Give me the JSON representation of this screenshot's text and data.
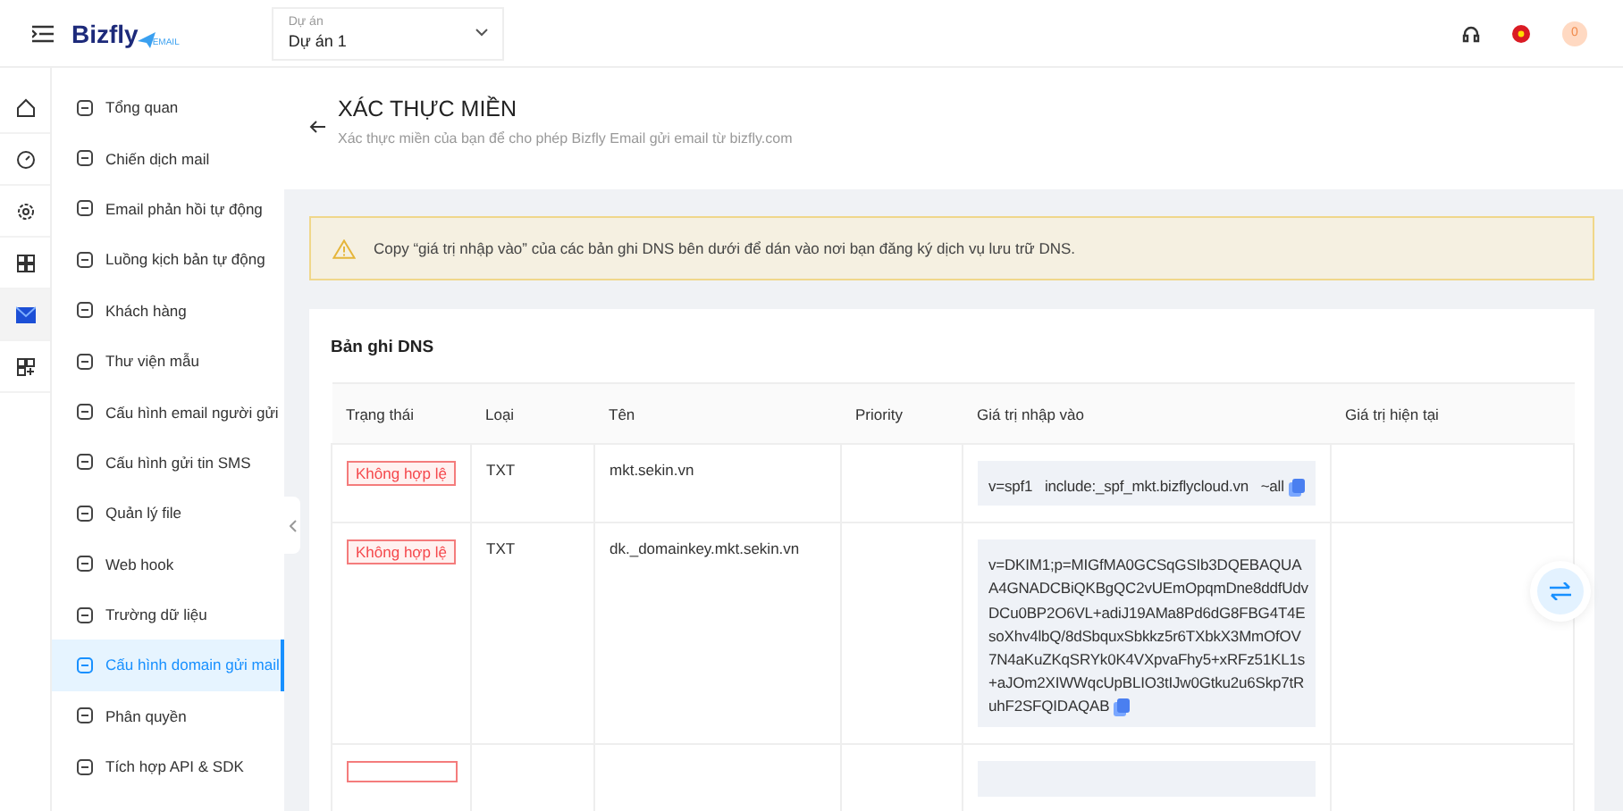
{
  "header": {
    "logo": "Bizfly",
    "logo_sub": "EMAIL",
    "project": {
      "label": "Dự án",
      "value": "Dự án 1"
    },
    "notification_count": "0"
  },
  "rail": [
    {
      "selected": false
    },
    {
      "selected": false
    },
    {
      "selected": false
    },
    {
      "selected": false
    },
    {
      "selected": true
    },
    {
      "selected": false
    }
  ],
  "sidebar": {
    "items": [
      {
        "label": "Tổng quan",
        "selected": false
      },
      {
        "label": "Chiến dịch mail",
        "selected": false
      },
      {
        "label": "Email phản hồi tự động",
        "selected": false
      },
      {
        "label": "Luồng kịch bản tự động",
        "selected": false
      },
      {
        "label": "Khách hàng",
        "selected": false
      },
      {
        "label": "Thư viện mẫu",
        "selected": false
      },
      {
        "label": "Cấu hình email người gửi",
        "selected": false
      },
      {
        "label": "Cấu hình gửi tin SMS",
        "selected": false
      },
      {
        "label": "Quản lý file",
        "selected": false
      },
      {
        "label": "Web hook",
        "selected": false
      },
      {
        "label": "Trường dữ liệu",
        "selected": false
      },
      {
        "label": "Cấu hình domain gửi mail",
        "selected": true
      },
      {
        "label": "Phân quyền",
        "selected": false
      },
      {
        "label": "Tích hợp API & SDK",
        "selected": false
      }
    ]
  },
  "page": {
    "title": "XÁC THỰC MIỀN",
    "subtitle": "Xác thực miền của bạn để cho phép Bizfly Email gửi email từ bizfly.com"
  },
  "alert": "Copy “giá trị nhập vào” của các bản ghi DNS bên dưới để dán vào nơi bạn đăng ký dịch vụ lưu trữ DNS.",
  "dns": {
    "title": "Bản ghi DNS",
    "columns": [
      "Trạng thái",
      "Loại",
      "Tên",
      "Priority",
      "Giá trị nhập vào",
      "Giá trị hiện tại"
    ],
    "rows": [
      {
        "status": "Không hợp lệ",
        "type": "TXT",
        "name": "mkt.sekin.vn",
        "value": "v=spf1   include:_spf_mkt.bizflycloud.vn   ~all"
      },
      {
        "status": "Không hợp lệ",
        "type": "TXT",
        "name": "dk._domainkey.mkt.sekin.vn",
        "value": "v=DKIM1;p=MIGfMA0GCSqGSIb3DQEBAQUAA4GNADCBiQKBgQC2vUEmOpqmDne8ddfUdvDCu0BP2O6VL+adiJ19AMa8Pd6dG8FBG4T4EsoXhv4lbQ/8dSbquxSbkkz5r6TXbkX3MmOfOV7N4aKuZKqSRYk0K4VXpvaFhy5+xRFz51KL1s+aJOm2XIWWqcUpBLIO3tIJw0Gtku2u6Skp7tRuhF2SFQIDAQAB"
      }
    ]
  }
}
